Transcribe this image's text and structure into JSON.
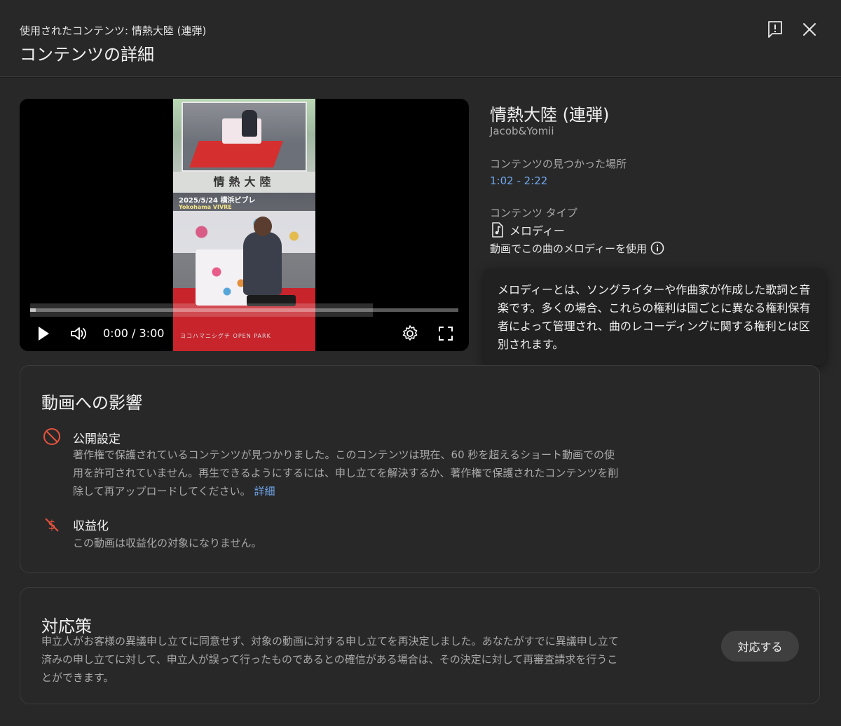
{
  "header": {
    "subtitle": "使用されたコンテンツ: 情熱大陸 (連弾)",
    "title": "コンテンツの詳細"
  },
  "player": {
    "time": "0:00 / 3:00",
    "progress_fraction": 0.0,
    "buffered_fraction": 0.8,
    "thumbnail": {
      "band_text": "情熱大陸",
      "caption_line1": "2025/5/24 横浜ビブレ",
      "caption_line2": "Yokohama VIVRE",
      "watermark": "ヨコハマニシグチ OPEN PARK"
    }
  },
  "content": {
    "song_title": "情熱大陸 (連弾)",
    "artist": "Jacob&Yomii",
    "found_label": "コンテンツの見つかった場所",
    "found_range": "1:02 - 2:22",
    "type_label": "コンテンツ タイプ",
    "type_value": "メロディー",
    "usage_text": "動画でこの曲のメロディーを使用"
  },
  "tooltip": {
    "text": "メロディーとは、ソングライターや作曲家が作成した歌詞と音楽です。多くの場合、これらの権利は国ごとに異なる権利保有者によって管理され、曲のレコーディングに関する権利とは区別されます。"
  },
  "impact": {
    "title": "動画への影響",
    "visibility_heading": "公開設定",
    "visibility_body": "著作権で保護されているコンテンツが見つかりました。このコンテンツは現在、60 秒を超えるショート動画での使用を許可されていません。再生できるようにするには、申し立てを解決するか、著作権で保護されたコンテンツを削除して再アップロードしてください。",
    "visibility_link": "詳細",
    "monetization_heading": "収益化",
    "monetization_body": "この動画は収益化の対象になりません。"
  },
  "action": {
    "title": "対応策",
    "body": "申立人がお客様の異議申し立てに同意せず、対象の動画に対する申し立てを再決定しました。あなたがすでに異議申し立て済みの申し立てに対して、申立人が誤って行ったものであるとの確信がある場合は、その決定に対して再審査請求を行うことができます。",
    "button_label": "対応する"
  },
  "colors": {
    "background": "#282828",
    "link": "#6fa7ee",
    "warning_icon": "#e5533d"
  }
}
